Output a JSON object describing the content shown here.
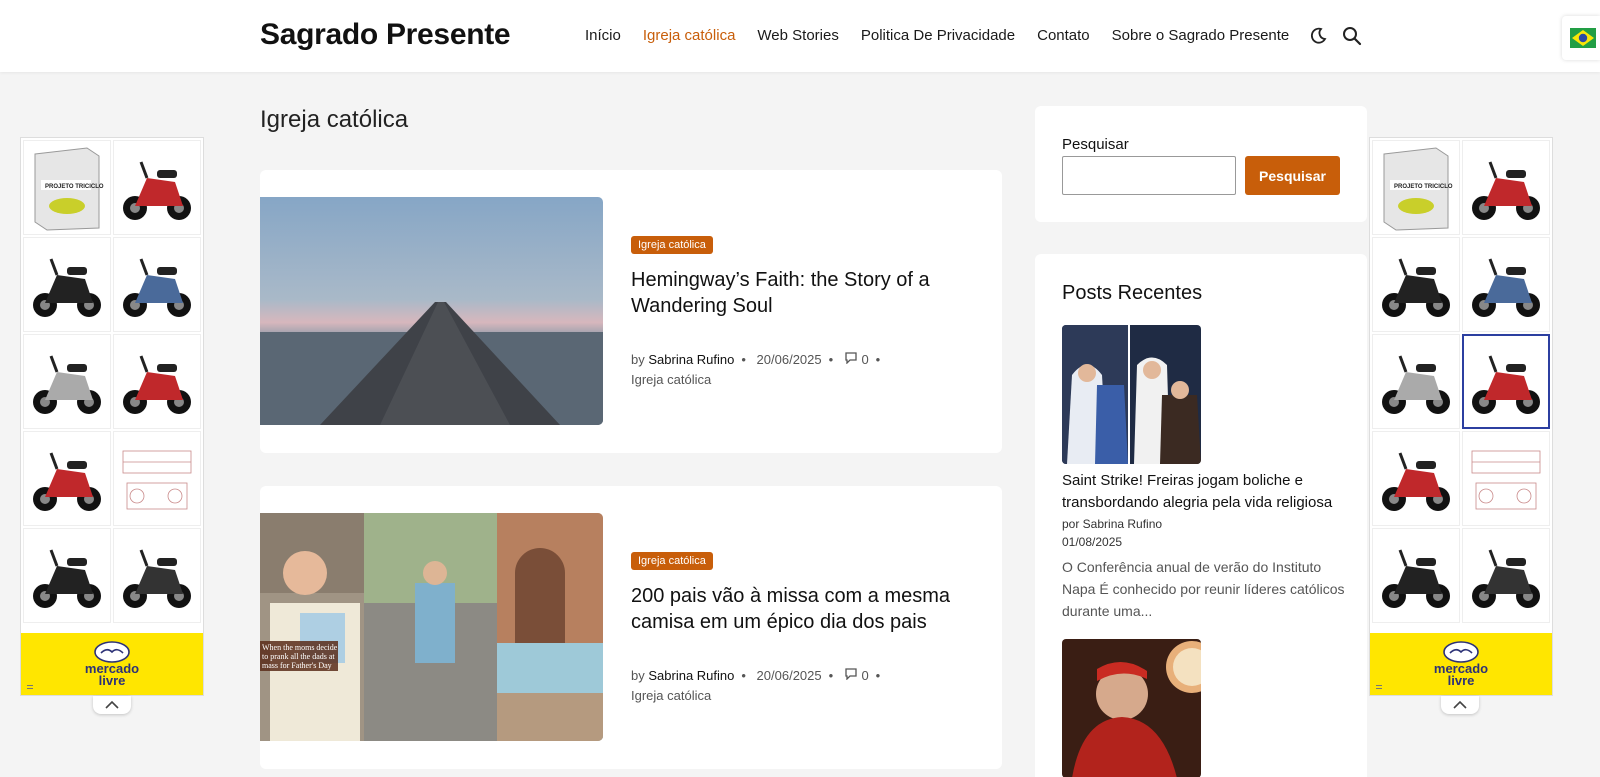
{
  "header": {
    "site_title": "Sagrado Presente",
    "nav": [
      "Início",
      "Igreja católica",
      "Web Stories",
      "Politica De Privacidade",
      "Contato",
      "Sobre o Sagrado Presente"
    ],
    "active_nav": "Igreja católica"
  },
  "page": {
    "title": "Igreja católica"
  },
  "posts": [
    {
      "badge": "Igreja católica",
      "title": "Hemingway’s Faith: the Story of a Wandering Soul",
      "by": "by",
      "author": "Sabrina Rufino",
      "date": "20/06/2025",
      "comments": "0",
      "category": "Igreja católica"
    },
    {
      "badge": "Igreja católica",
      "title": "200 pais vão à missa com a mesma camisa em um épico dia dos pais",
      "by": "by",
      "author": "Sabrina Rufino",
      "date": "20/06/2025",
      "comments": "0",
      "category": "Igreja católica",
      "image_caption": "When the moms decide to prank all the dads at mass for Father's Day"
    }
  ],
  "sidebar": {
    "search": {
      "label": "Pesquisar",
      "button": "Pesquisar"
    },
    "recent": {
      "heading": "Posts Recentes",
      "items": [
        {
          "title": "Saint Strike! Freiras jogam boliche e transbordando alegria pela vida religiosa",
          "by": "por Sabrina Rufino",
          "date": "01/08/2025",
          "excerpt": "O Conferência anual de verão do Instituto Napa É conhecido por reunir líderes católicos durante uma..."
        }
      ]
    }
  },
  "ads": {
    "brand_line1": "mercado",
    "brand_line2": "livre",
    "product_box_text": "PROJETO TRICICLO"
  },
  "colors": {
    "accent": "#c85e0a",
    "ad_yellow": "#ffe600"
  }
}
